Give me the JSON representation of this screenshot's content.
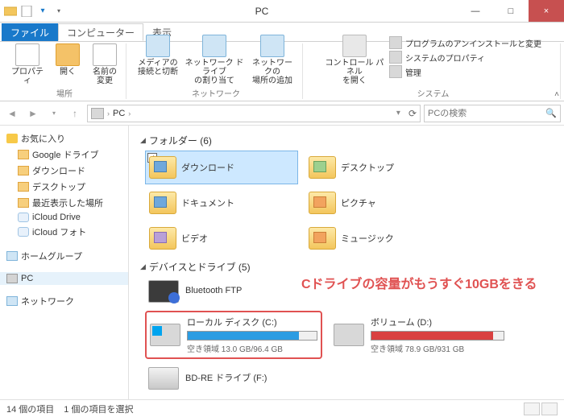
{
  "window": {
    "title": "PC",
    "minimize": "―",
    "maximize": "□",
    "close": "×"
  },
  "tabs": {
    "file": "ファイル",
    "computer": "コンピューター",
    "view": "表示"
  },
  "ribbon": {
    "properties": "プロパティ",
    "open": "開く",
    "rename": "名前の\n変更",
    "group_location": "場所",
    "media": "メディアの\n接続と切断",
    "netdrivemap": "ネットワーク ドライブ\nの割り当て",
    "addnet": "ネットワークの\n場所の追加",
    "group_network": "ネットワーク",
    "controlpanel": "コントロール パネル\nを開く",
    "uninstall": "プログラムのアンインストールと変更",
    "sysprop": "システムのプロパティ",
    "manage": "管理",
    "group_system": "システム"
  },
  "nav": {
    "path": "PC",
    "search_placeholder": "PCの検索",
    "refresh": "⟳",
    "dropdown": "▾"
  },
  "sidebar": {
    "favorites": "お気に入り",
    "fav_items": [
      {
        "label": "Google ドライブ",
        "ico": "ico-folder"
      },
      {
        "label": "ダウンロード",
        "ico": "ico-folder"
      },
      {
        "label": "デスクトップ",
        "ico": "ico-folder"
      },
      {
        "label": "最近表示した場所",
        "ico": "ico-folder"
      },
      {
        "label": "iCloud Drive",
        "ico": "ico-cloud"
      },
      {
        "label": "iCloud フォト",
        "ico": "ico-cloud"
      }
    ],
    "homegroup": "ホームグループ",
    "pc": "PC",
    "network": "ネットワーク"
  },
  "content": {
    "folders_head": "フォルダー (6)",
    "folders": [
      {
        "label": "ダウンロード",
        "selected": true,
        "cls": ""
      },
      {
        "label": "デスクトップ",
        "cls": "green"
      },
      {
        "label": "ドキュメント",
        "cls": ""
      },
      {
        "label": "ピクチャ",
        "cls": "orange"
      },
      {
        "label": "ビデオ",
        "cls": "purple"
      },
      {
        "label": "ミュージック",
        "cls": "orange"
      }
    ],
    "drives_head": "デバイスとドライブ (5)",
    "bluetooth": "Bluetooth FTP",
    "c_drive": {
      "name": "ローカル ディスク (C:)",
      "free": "空き領域 13.0 GB/96.4 GB",
      "fill_pct": 86
    },
    "d_drive": {
      "name": "ボリューム (D:)",
      "free": "空き領域 78.9 GB/931 GB",
      "fill_pct": 92
    },
    "bd_drive": "BD-RE ドライブ (F:)",
    "annotation": "Cドライブの容量がもうすぐ10GBをきる"
  },
  "status": {
    "items": "14 個の項目",
    "selected": "1 個の項目を選択"
  }
}
